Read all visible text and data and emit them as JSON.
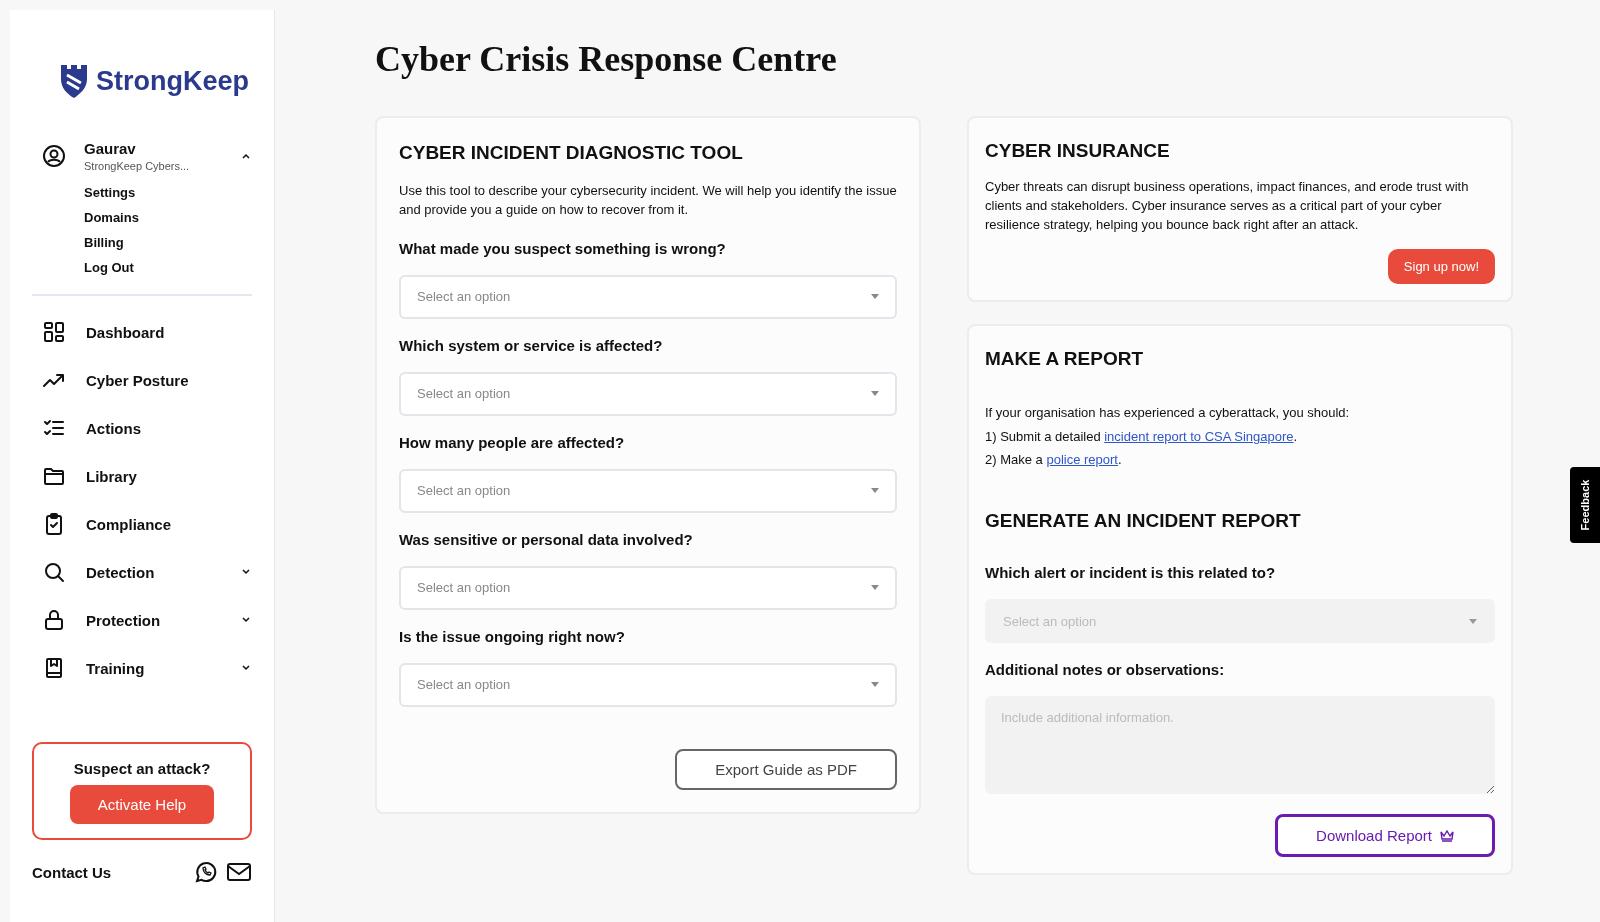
{
  "sidebar": {
    "brand": "StrongKeep",
    "profile": {
      "name": "Gaurav",
      "org": "StrongKeep Cybers...",
      "expanded": true,
      "menu": [
        "Settings",
        "Domains",
        "Billing",
        "Log Out"
      ]
    },
    "nav": [
      {
        "label": "Dashboard",
        "kind": "link"
      },
      {
        "label": "Cyber Posture",
        "kind": "link"
      },
      {
        "label": "Actions",
        "kind": "link"
      },
      {
        "label": "Library",
        "kind": "link"
      },
      {
        "label": "Compliance",
        "kind": "link"
      },
      {
        "label": "Detection",
        "kind": "group",
        "expanded": false
      },
      {
        "label": "Protection",
        "kind": "group",
        "expanded": false
      },
      {
        "label": "Training",
        "kind": "group",
        "expanded": false
      }
    ],
    "help": {
      "title": "Suspect an attack?",
      "button": "Activate Help"
    },
    "contact": "Contact Us"
  },
  "title": "Cyber Crisis Response Centre",
  "diagnostic": {
    "heading": "CYBER INCIDENT DIAGNOSTIC TOOL",
    "intro": "Use this tool to describe your cybersecurity incident. We will help you identify the issue and provide you a guide on how to recover from it.",
    "questions": [
      {
        "label": "What made you suspect something is wrong?",
        "placeholder": "Select an option",
        "disabled": false
      },
      {
        "label": "Which system or service is affected?",
        "placeholder": "Select an option",
        "disabled": false
      },
      {
        "label": "How many people are affected?",
        "placeholder": "Select an option",
        "disabled": false
      },
      {
        "label": "Was sensitive or personal data involved?",
        "placeholder": "Select an option",
        "disabled": false
      },
      {
        "label": "Is the issue ongoing right now?",
        "placeholder": "Select an option",
        "disabled": false
      }
    ],
    "button": "Export Guide as PDF"
  },
  "insurance": {
    "heading": "CYBER INSURANCE",
    "text": "Cyber threats can disrupt business operations, impact finances, and erode trust with clients and stakeholders. Cyber insurance serves as a critical part of your cyber resilience strategy, helping you bounce back right after an attack.",
    "button": "Sign up now!"
  },
  "report": {
    "heading": "MAKE A REPORT",
    "intro": "If your organisation has experienced a cyberattack, you should:",
    "steps": [
      {
        "before": "1) Submit a detailed ",
        "link": "incident report to CSA Singapore",
        "after": "."
      },
      {
        "before": "2) Make a ",
        "link": "police report",
        "after": "."
      }
    ]
  },
  "generate": {
    "heading": "GENERATE AN INCIDENT REPORT",
    "select": {
      "label": "Which alert or incident is this related to?",
      "placeholder": "Select an option",
      "disabled": true
    },
    "notes": {
      "label": "Additional notes or observations:",
      "placeholder": "Include additional information."
    },
    "button": "Download Report"
  },
  "feedback": "Feedback"
}
